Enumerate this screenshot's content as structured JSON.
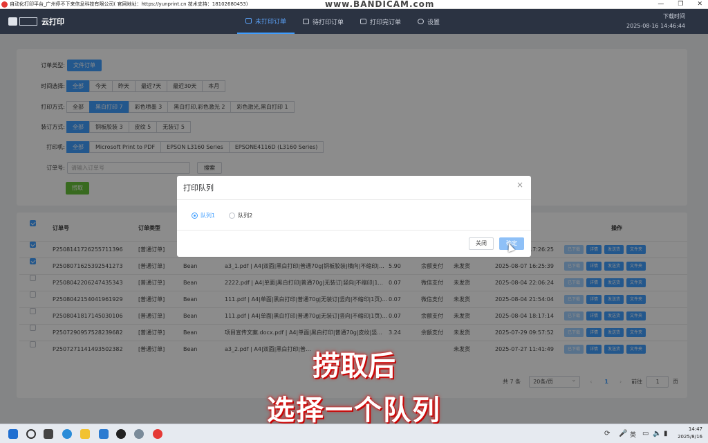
{
  "titlebar": {
    "title": "自动化打印平台_广州停不下来信息科技有限公司( 官网地址：https://yunprint.cn 技术支持：18102680453)",
    "watermark": "www.BANDICAM.com",
    "controls": [
      "—",
      "❐",
      "✕"
    ]
  },
  "topnav": {
    "brand": "云打印",
    "tabs": [
      {
        "label": "未打印订单",
        "active": true
      },
      {
        "label": "待打印订单",
        "active": false
      },
      {
        "label": "打印完订单",
        "active": false
      },
      {
        "label": "设置",
        "active": false
      }
    ],
    "download_time_label": "下载时间",
    "download_time": "2025-08-16 14:46:44"
  },
  "filters": {
    "order_type": {
      "label": "订单类型:",
      "options": [
        "文件订单"
      ],
      "selected": 0
    },
    "time": {
      "label": "时间选择:",
      "options": [
        "全部",
        "今天",
        "昨天",
        "最近7天",
        "最近30天",
        "本月"
      ],
      "selected": 0
    },
    "print_mode": {
      "label": "打印方式:",
      "options": [
        "全部",
        "黑白打印 7",
        "彩色喷墨 3",
        "黑白打印,彩色激光 2",
        "彩色激光,黑白打印 1"
      ],
      "selected": 1
    },
    "binding": {
      "label": "装订方式:",
      "options": [
        "全部",
        "铜板胶装 3",
        "皮纹 5",
        "无装订 5"
      ],
      "selected": 0
    },
    "printer": {
      "label": "打印机:",
      "options": [
        "全部",
        "Microsoft Print to PDF",
        "EPSON L3160 Series",
        "EPSONE4116D (L3160 Series)"
      ],
      "selected": 0
    },
    "order_no": {
      "label": "订单号:",
      "placeholder": "请输入订单号",
      "search_button": "搜索"
    },
    "grab_button": "捞取"
  },
  "table": {
    "headers": {
      "order_no": "订单号",
      "order_type": "订单类型",
      "ops": "操作"
    },
    "rows": [
      {
        "checked": true,
        "order_no": "P2508141726255711396",
        "type": "[普通订单]",
        "user": "",
        "file": "",
        "amount": "",
        "pay": "",
        "ship": "",
        "time": "2025-08-14 17:26:25"
      },
      {
        "checked": true,
        "order_no": "P2508071625392541273",
        "type": "[普通订单]",
        "user": "Bean",
        "file": "a3_1.pdf | A4|双面|黑白打印|普通70g|铜板胶装|横向|不缩印|...",
        "amount": "5.90",
        "pay": "余额支付",
        "ship": "未发货",
        "time": "2025-08-07 16:25:39"
      },
      {
        "checked": false,
        "order_no": "P2508042206247435343",
        "type": "[普通订单]",
        "user": "Bean",
        "file": "2222.pdf | A4|单面|黑白打印|普通70g|无装订|竖向|不缩印|1...",
        "amount": "0.07",
        "pay": "微信支付",
        "ship": "未发货",
        "time": "2025-08-04 22:06:24"
      },
      {
        "checked": false,
        "order_no": "P2508042154041961929",
        "type": "[普通订单]",
        "user": "Bean",
        "file": "111.pdf | A4|单面|黑白打印|普通70g|无装订|竖向|不缩印|1页)...",
        "amount": "0.07",
        "pay": "微信支付",
        "ship": "未发货",
        "time": "2025-08-04 21:54:04"
      },
      {
        "checked": false,
        "order_no": "P2508041817145030106",
        "type": "[普通订单]",
        "user": "Bean",
        "file": "111.pdf | A4|单面|黑白打印|普通70g|无装订|竖向|不缩印|1页)...",
        "amount": "0.07",
        "pay": "余额支付",
        "ship": "未发货",
        "time": "2025-08-04 18:17:14"
      },
      {
        "checked": false,
        "order_no": "P2507290957528239682",
        "type": "[普通订单]",
        "user": "Bean",
        "file": "项目宣传文案.docx.pdf | A4|单面|黑白打印|普通70g|皮纹|竖...",
        "amount": "3.24",
        "pay": "余额支付",
        "ship": "未发货",
        "time": "2025-07-29 09:57:52"
      },
      {
        "checked": false,
        "order_no": "P2507271141493502382",
        "type": "[普通订单]",
        "user": "Bean",
        "file": "a3_2.pdf | A4|双面|黑白打印|普...",
        "amount": "",
        "pay": "",
        "ship": "未发货",
        "time": "2025-07-27 11:41:49"
      }
    ],
    "op_labels": [
      "已下载",
      "详情",
      "发送货",
      "文件夹"
    ]
  },
  "pager": {
    "total": "共 7 条",
    "page_size": "20条/页",
    "prev": "‹",
    "current": "1",
    "next": "›",
    "goto_label": "前往",
    "goto_value": "1",
    "page_unit": "页"
  },
  "dialog": {
    "title": "打印队列",
    "close_icon": "×",
    "options": [
      {
        "label": "队列1",
        "selected": true
      },
      {
        "label": "队列2",
        "selected": false
      }
    ],
    "cancel": "关闭",
    "confirm": "确定"
  },
  "captions": {
    "line1": "捞取后",
    "line2": "选择一个队列"
  },
  "taskbar": {
    "lang": "英",
    "time": "14:47",
    "date": "2025/8/16"
  },
  "colors": {
    "primary": "#409eff",
    "nav_bg": "#2b3342",
    "success": "#67c23a"
  }
}
